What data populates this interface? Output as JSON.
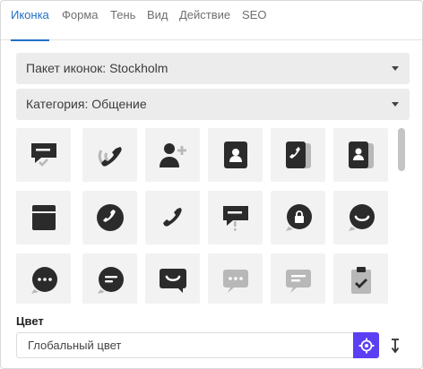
{
  "tabs": [
    {
      "label": "Иконка",
      "active": true
    },
    {
      "label": "Форма"
    },
    {
      "label": "Тень"
    },
    {
      "label": "Вид"
    },
    {
      "label": "Действие"
    },
    {
      "label": "SEO"
    }
  ],
  "icon_pack_select": {
    "value": "Пакет иконок: Stockholm"
  },
  "category_select": {
    "value": "Категория: Общение"
  },
  "icons": [
    "chat-check-icon",
    "phone-waves-icon",
    "add-user-icon",
    "contact-card-icon",
    "phone-book-icon",
    "contact-book-icon",
    "archive-icon",
    "phone-circle-icon",
    "phone-icon",
    "chat-alert-icon",
    "chat-lock-icon",
    "chat-smile-icon",
    "chat-dots-circle-icon",
    "chat-lines-circle-icon",
    "chat-smile-square-icon",
    "chat-dots-square-icon",
    "chat-lines-square-icon",
    "clipboard-check-icon"
  ],
  "color": {
    "label": "Цвет",
    "value": "Глобальный цвет",
    "accent": "#5b3ff3"
  },
  "colors": {
    "active_tab": "#2270c9",
    "icon_dark": "#2b2b2b",
    "icon_light": "#b8b8b8"
  }
}
